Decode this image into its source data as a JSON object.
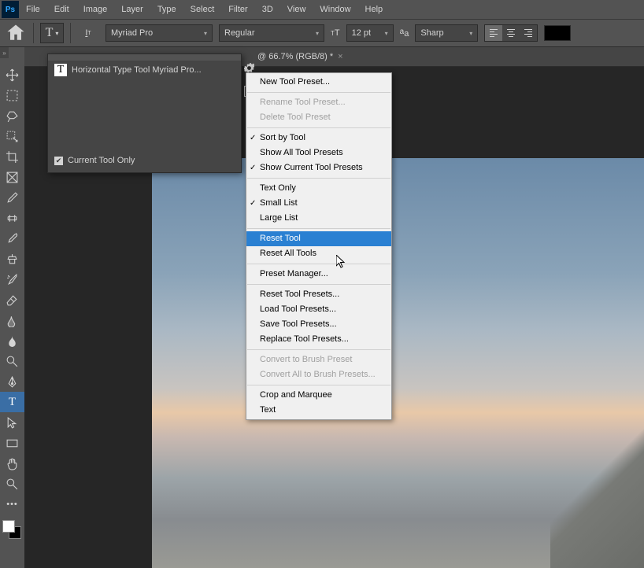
{
  "menu": {
    "items": [
      "File",
      "Edit",
      "Image",
      "Layer",
      "Type",
      "Select",
      "Filter",
      "3D",
      "View",
      "Window",
      "Help"
    ]
  },
  "options": {
    "font_family": "Myriad Pro",
    "font_style": "Regular",
    "font_size": "12 pt",
    "aa_mode": "Sharp"
  },
  "doc_tab": {
    "title": "@ 66.7% (RGB/8) *"
  },
  "preset_panel": {
    "item_label": "Horizontal Type Tool Myriad Pro...",
    "footer_label": "Current Tool Only"
  },
  "context_menu": {
    "new_preset": "New Tool Preset...",
    "rename_preset": "Rename Tool Preset...",
    "delete_preset": "Delete Tool Preset",
    "sort_by_tool": "Sort by Tool",
    "show_all": "Show All Tool Presets",
    "show_current": "Show Current Tool Presets",
    "text_only": "Text Only",
    "small_list": "Small List",
    "large_list": "Large List",
    "reset_tool": "Reset Tool",
    "reset_all": "Reset All Tools",
    "preset_manager": "Preset Manager...",
    "reset_tool_presets": "Reset Tool Presets...",
    "load_tool_presets": "Load Tool Presets...",
    "save_tool_presets": "Save Tool Presets...",
    "replace_tool_presets": "Replace Tool Presets...",
    "convert_brush": "Convert to Brush Preset",
    "convert_all_brush": "Convert All to Brush Presets...",
    "crop_marquee": "Crop and Marquee",
    "text": "Text"
  }
}
